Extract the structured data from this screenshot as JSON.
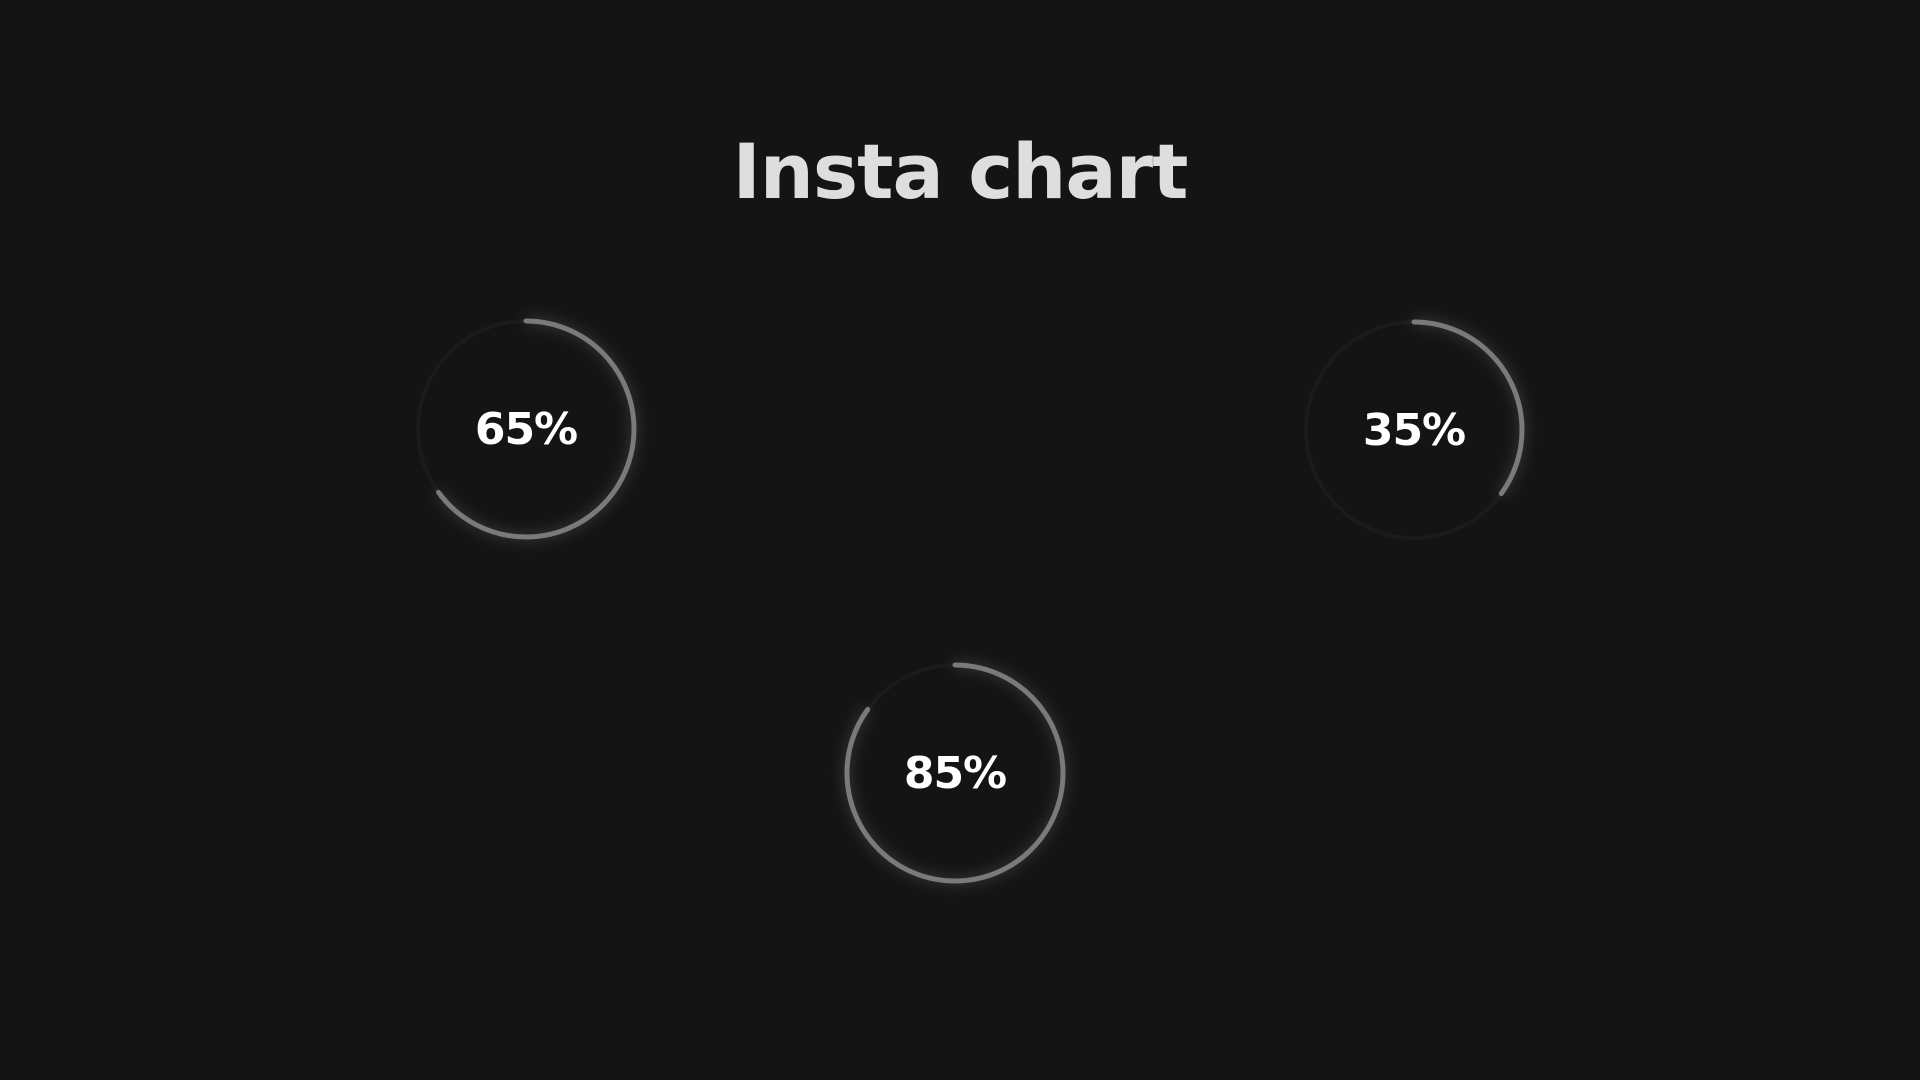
{
  "page": {
    "title": "Insta chart"
  },
  "colors": {
    "background": "#141414",
    "title": "#dedede",
    "track": "#1b1b1b",
    "progress": "#7a7a7a",
    "value_text": "#ffffff"
  },
  "chart_data": {
    "type": "radial-progress",
    "title": "Insta chart",
    "values": [
      65,
      35,
      85
    ],
    "labels": [
      "65%",
      "35%",
      "85%"
    ],
    "max": 100
  }
}
